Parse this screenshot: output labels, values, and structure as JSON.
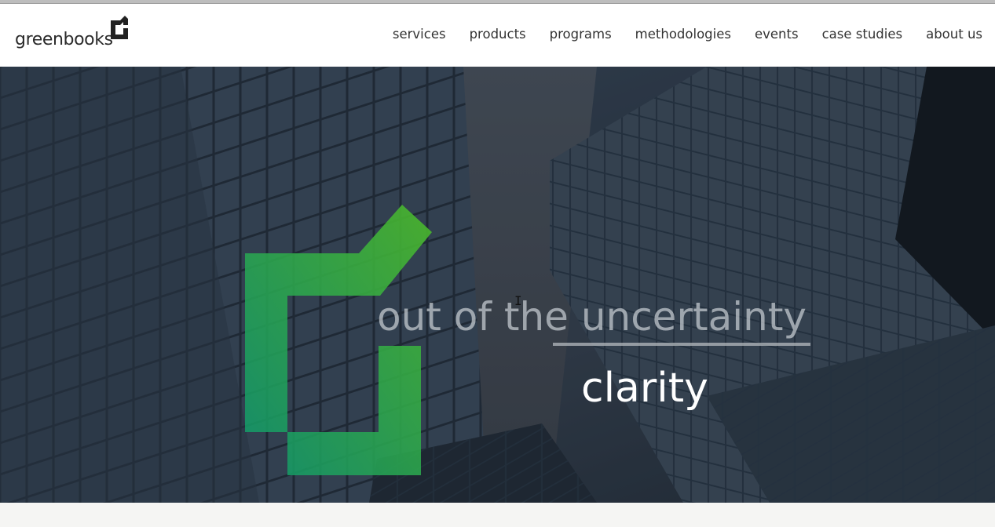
{
  "brand": {
    "name": "greenbooks",
    "accent_green": "#3dae2b",
    "accent_teal": "#0f9a6e"
  },
  "nav": {
    "items": [
      {
        "label": "services"
      },
      {
        "label": "products"
      },
      {
        "label": "programs"
      },
      {
        "label": "methodologies"
      },
      {
        "label": "events"
      },
      {
        "label": "case studies"
      },
      {
        "label": "about us"
      }
    ]
  },
  "hero": {
    "headline": "out of the uncertainty",
    "subline": "clarity",
    "background": "building-facades-image",
    "cursor_icon": "text-cursor-icon"
  }
}
